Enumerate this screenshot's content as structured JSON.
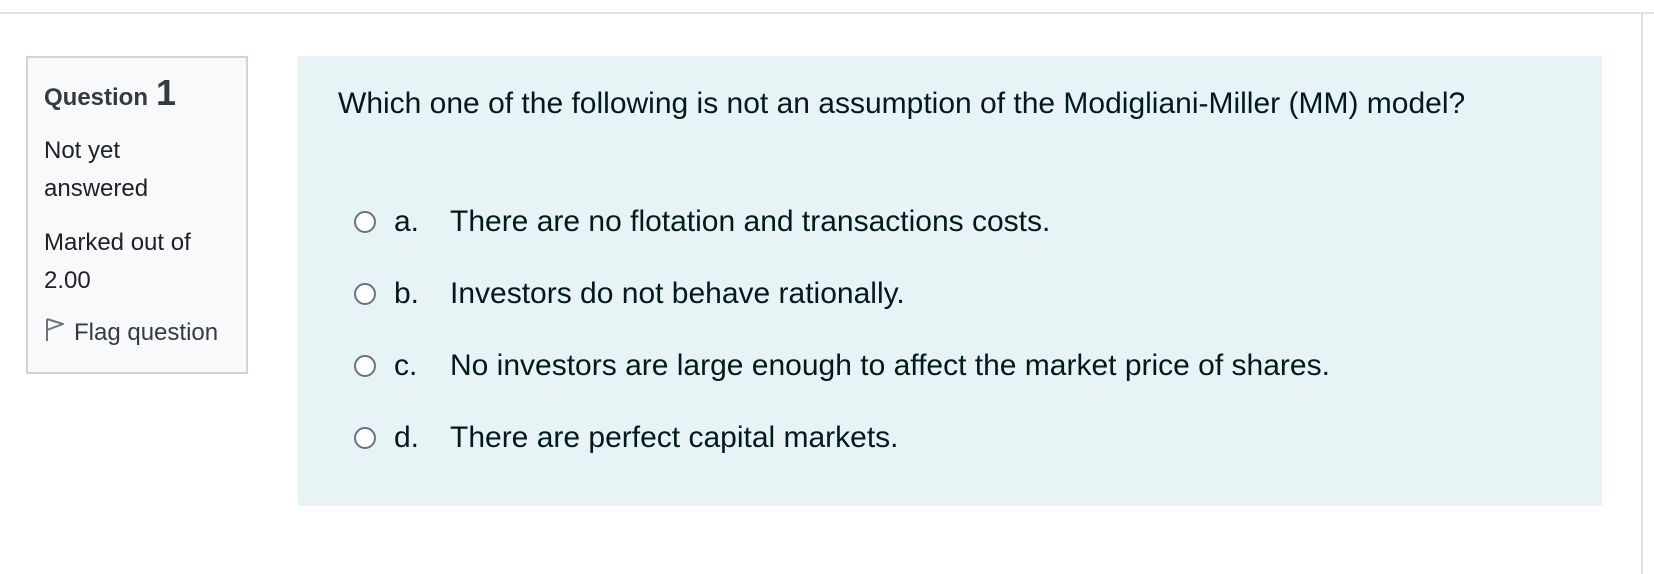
{
  "question_info": {
    "label": "Question",
    "number": "1",
    "state_line1": "Not yet",
    "state_line2": "answered",
    "grade_line1": "Marked out of",
    "grade_line2": "2.00",
    "flag_label": "Flag question",
    "flag_icon": "flag-outline-icon"
  },
  "question": {
    "text": "Which one of the following is not an assumption of the Modigliani-Miller (MM) model?",
    "answers": [
      {
        "letter": "a.",
        "text": "There are no flotation and transactions costs."
      },
      {
        "letter": "b.",
        "text": "Investors do not behave rationally."
      },
      {
        "letter": "c.",
        "text": "No investors are large enough to affect the market price of shares."
      },
      {
        "letter": "d.",
        "text": "There are perfect capital markets."
      }
    ]
  },
  "colors": {
    "content_background": "#e7f3f5",
    "info_background": "#f8f9fa",
    "info_border": "#cfd4da",
    "text": "#001a1e"
  }
}
